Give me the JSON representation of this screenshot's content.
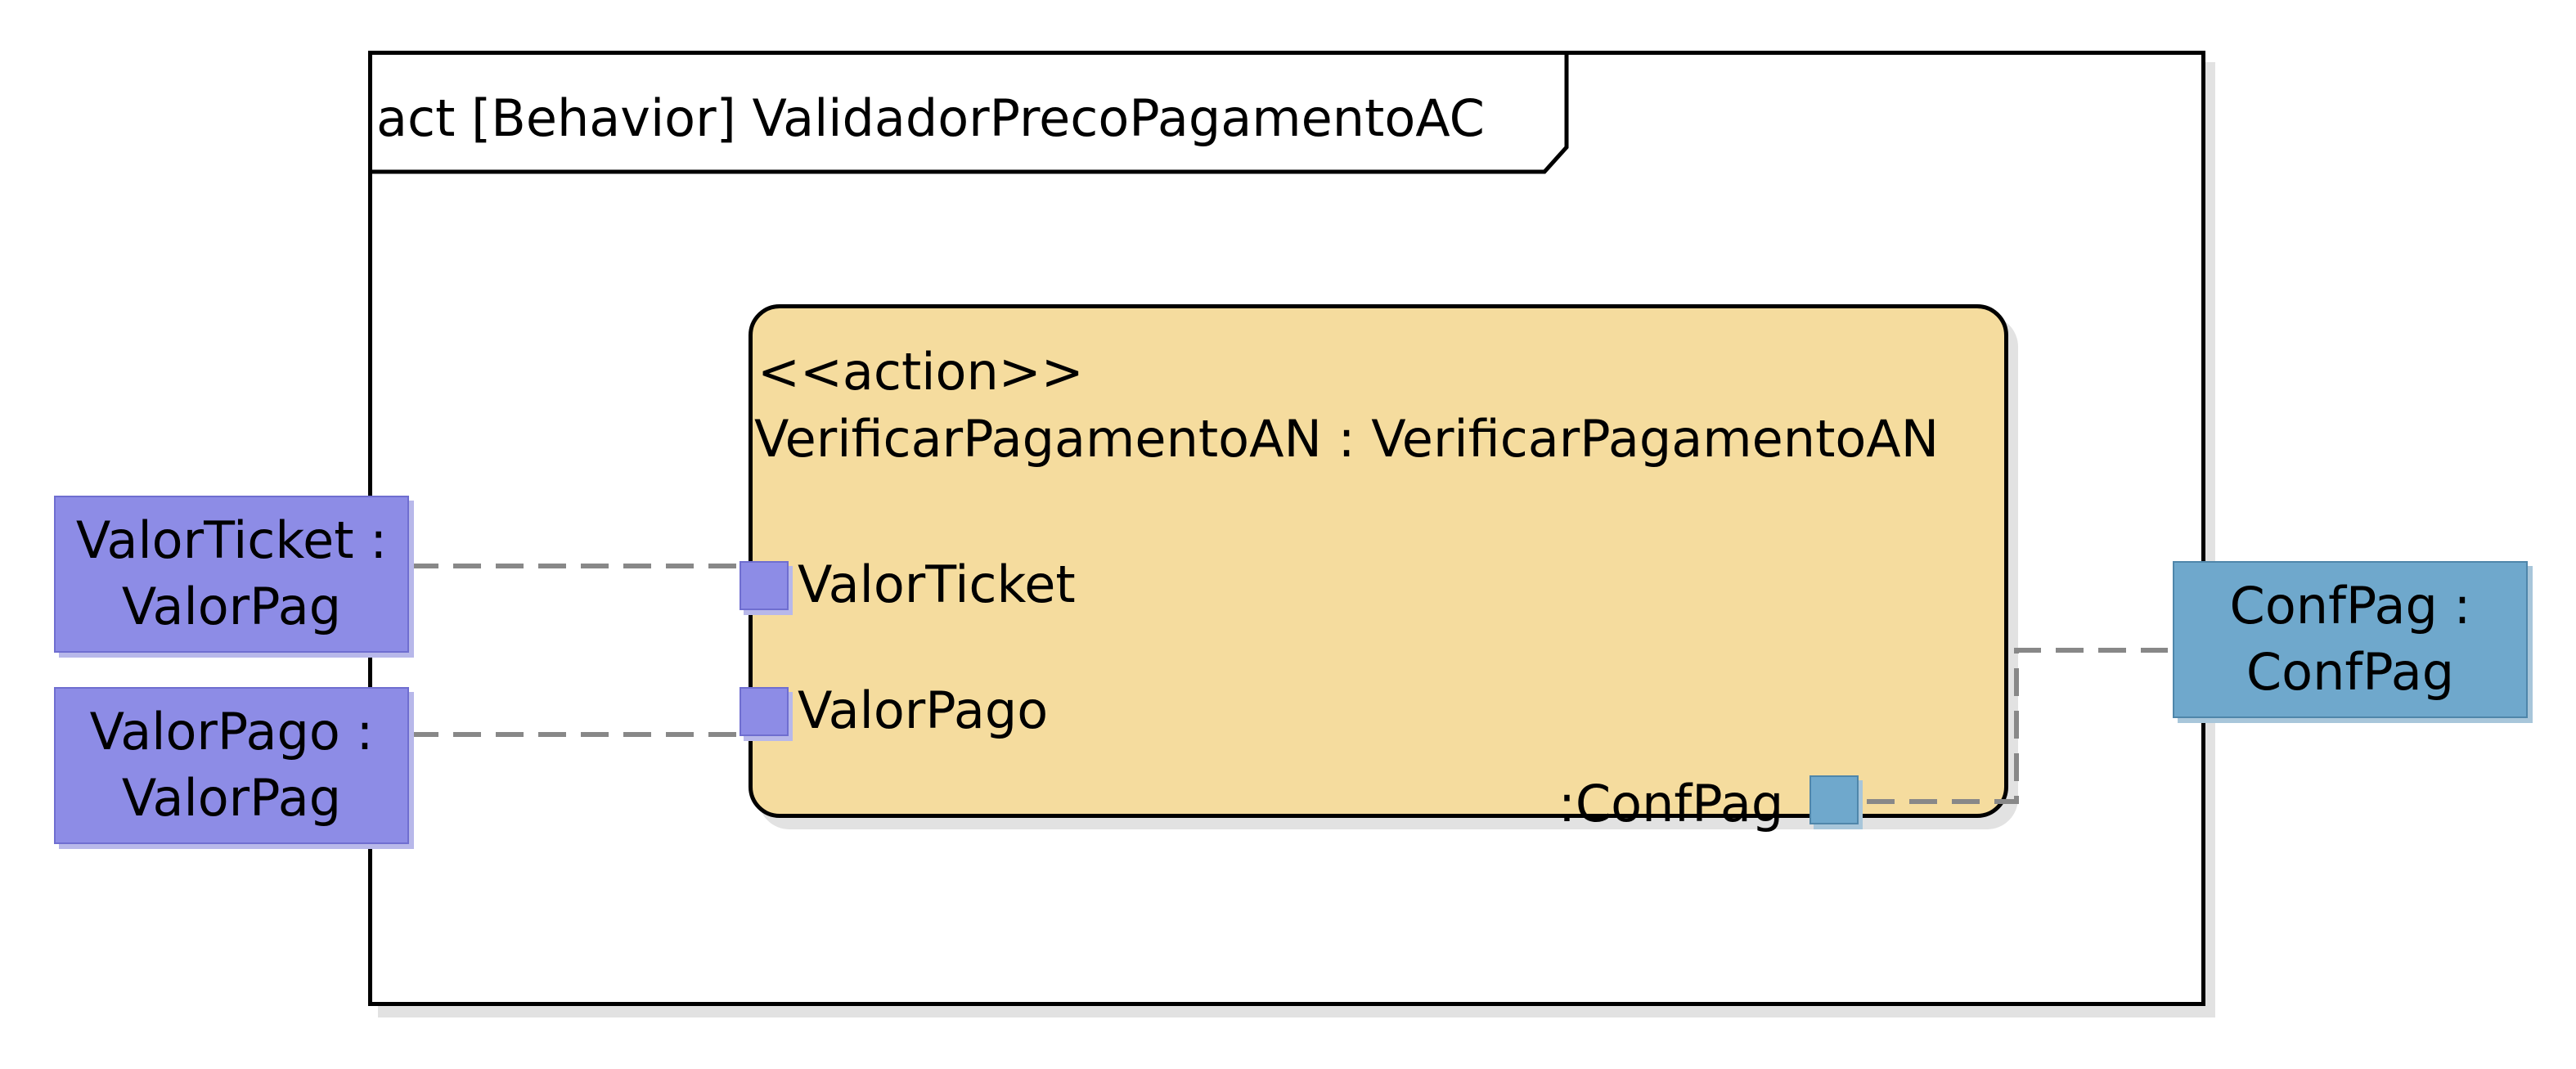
{
  "frame": {
    "title": "act [Behavior] ValidadorPrecoPagamentoAC"
  },
  "action": {
    "stereotype": "<<action>>",
    "name": "VerificarPagamentoAN : VerificarPagamentoAN",
    "pins": {
      "valor_ticket": "ValorTicket",
      "valor_pago": "ValorPago",
      "conf_pag": ":ConfPag"
    }
  },
  "parameters": {
    "valor_ticket": {
      "line1": "ValorTicket :",
      "line2": "ValorPag"
    },
    "valor_pago": {
      "line1": "ValorPago :",
      "line2": "ValorPag"
    },
    "conf_pag": {
      "line1": "ConfPag :",
      "line2": "ConfPag"
    }
  },
  "colors": {
    "action_fill": "#f5dc9e",
    "input_param_fill": "#8d8ce6",
    "output_param_fill": "#6fa8cc",
    "link_line": "#888888"
  }
}
